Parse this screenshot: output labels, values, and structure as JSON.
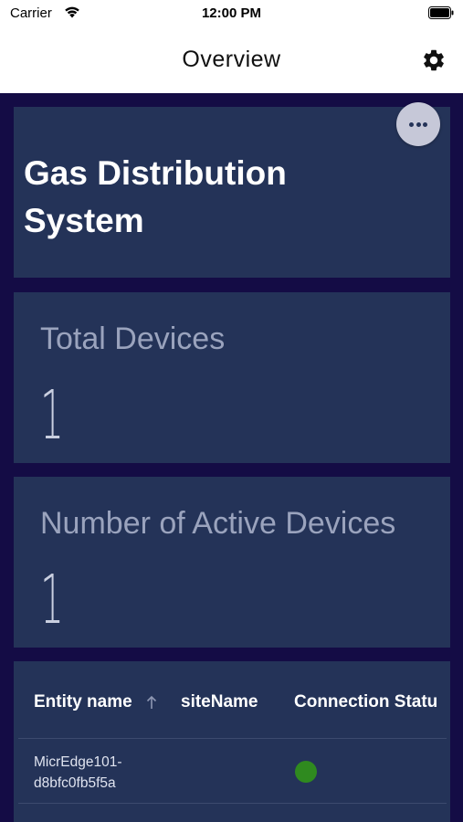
{
  "status_bar": {
    "carrier": "Carrier",
    "time": "12:00 PM"
  },
  "nav": {
    "title": "Overview",
    "settings_icon": "gear-icon"
  },
  "dashboard": {
    "system_title": "Gas Distribution System",
    "more_icon": "ellipsis-icon"
  },
  "stats": [
    {
      "label": "Total Devices",
      "value": "1"
    },
    {
      "label": "Number of Active Devices",
      "value": "1"
    }
  ],
  "table": {
    "columns": [
      "Entity name",
      "siteName",
      "Connection Statu"
    ],
    "sort": {
      "column": "Entity name",
      "direction": "ascending"
    },
    "rows": [
      {
        "entity_name": "MicrEdge101-d8bfc0fb5f5a",
        "site_name": "",
        "connection_status": "online",
        "status_color": "#2f8a1f"
      }
    ]
  },
  "colors": {
    "background": "#140c45",
    "card": "#243358",
    "status_online": "#2f8a1f"
  }
}
